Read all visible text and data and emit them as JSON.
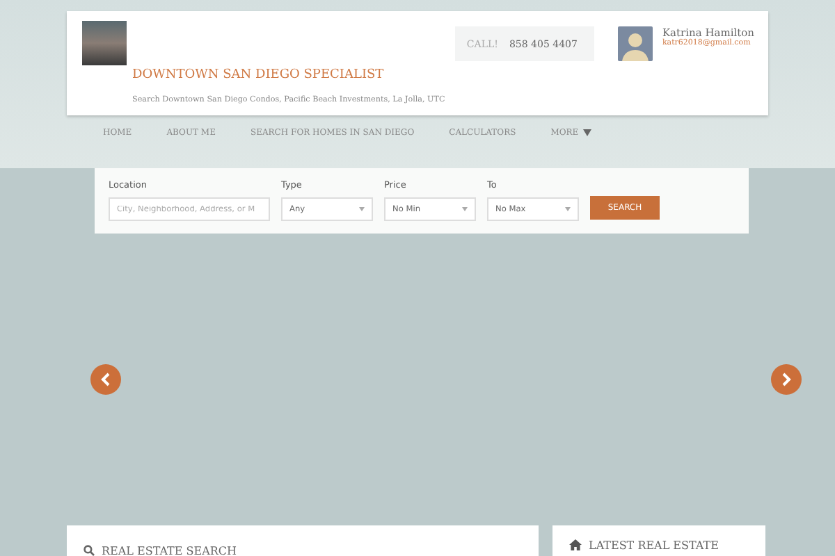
{
  "header": {
    "title": "DOWNTOWN SAN DIEGO SPECIALIST",
    "tagline": "Search Downtown San Diego Condos, Pacific Beach Investments, La Jolla, UTC",
    "call_label": "CALL!",
    "phone": "858 405 4407",
    "agent_name": "Katrina Hamilton",
    "agent_email": "katr62018@gmail.com"
  },
  "nav": [
    {
      "label": "HOME",
      "has_menu": false
    },
    {
      "label": "ABOUT ME",
      "has_menu": false
    },
    {
      "label": "SEARCH FOR HOMES IN SAN DIEGO",
      "has_menu": false
    },
    {
      "label": "CALCULATORS",
      "has_menu": false
    },
    {
      "label": "MORE",
      "has_menu": true
    }
  ],
  "search": {
    "fields": [
      {
        "kind": "text",
        "label": "Location",
        "placeholder": "City, Neighborhood, Address, or M"
      },
      {
        "kind": "select",
        "label": "Type",
        "value": "Any"
      },
      {
        "kind": "select",
        "label": "Price",
        "value": "No Min"
      },
      {
        "kind": "select",
        "label": "To",
        "value": "No Max"
      }
    ],
    "button": "SEARCH"
  },
  "panels": [
    {
      "kind": "search",
      "title": "REAL ESTATE SEARCH"
    },
    {
      "kind": "home",
      "title": "LATEST REAL ESTATE"
    }
  ]
}
